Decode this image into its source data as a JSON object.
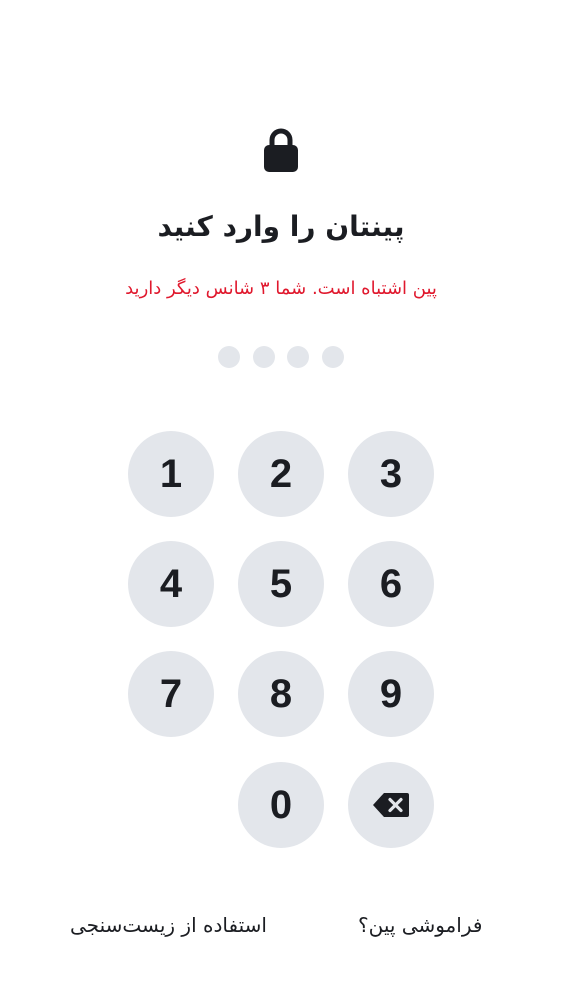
{
  "header": {
    "icon": "lock-icon",
    "title": "پینتان را وارد کنید",
    "error_message": "پین اشتباه است. شما ۳ شانس دیگر دارید"
  },
  "pin": {
    "length": 4,
    "filled": 0
  },
  "keypad": {
    "keys": [
      "1",
      "2",
      "3",
      "4",
      "5",
      "6",
      "7",
      "8",
      "9",
      "0"
    ],
    "backspace_icon": "backspace-icon"
  },
  "footer": {
    "forgot_pin": "فراموشی پین؟",
    "use_biometrics": "استفاده از زیست‌سنجی"
  },
  "colors": {
    "background": "#ffffff",
    "text": "#1b1d22",
    "error": "#e0182d",
    "key_background": "#e3e6eb"
  }
}
